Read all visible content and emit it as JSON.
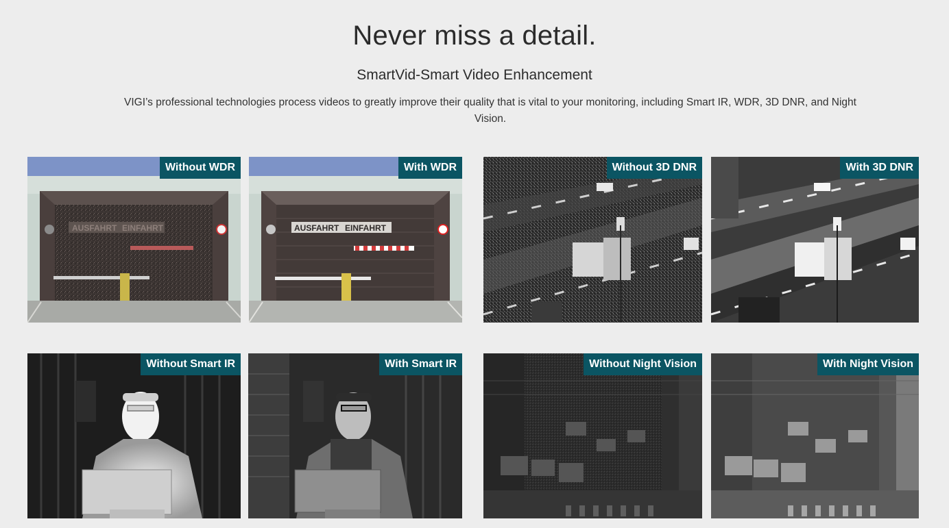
{
  "section": {
    "title": "Never miss a detail.",
    "subtitle": "SmartVid-Smart Video Enhancement",
    "description": "VIGI’s professional technologies process videos to greatly improve their quality that is vital to your monitoring, including Smart IR, WDR, 3D DNR, and Night Vision."
  },
  "comparisons": {
    "wdr": {
      "without_label": "Without WDR",
      "with_label": "With WDR",
      "sign_left": "AUSFAHRT",
      "sign_right": "EINFAHRT",
      "speed_sign": "10"
    },
    "dnr": {
      "without_label": "Without 3D DNR",
      "with_label": "With 3D DNR"
    },
    "smart_ir": {
      "without_label": "Without Smart IR",
      "with_label": "With Smart IR"
    },
    "night_vision": {
      "without_label": "Without Night Vision",
      "with_label": "With Night Vision"
    }
  }
}
